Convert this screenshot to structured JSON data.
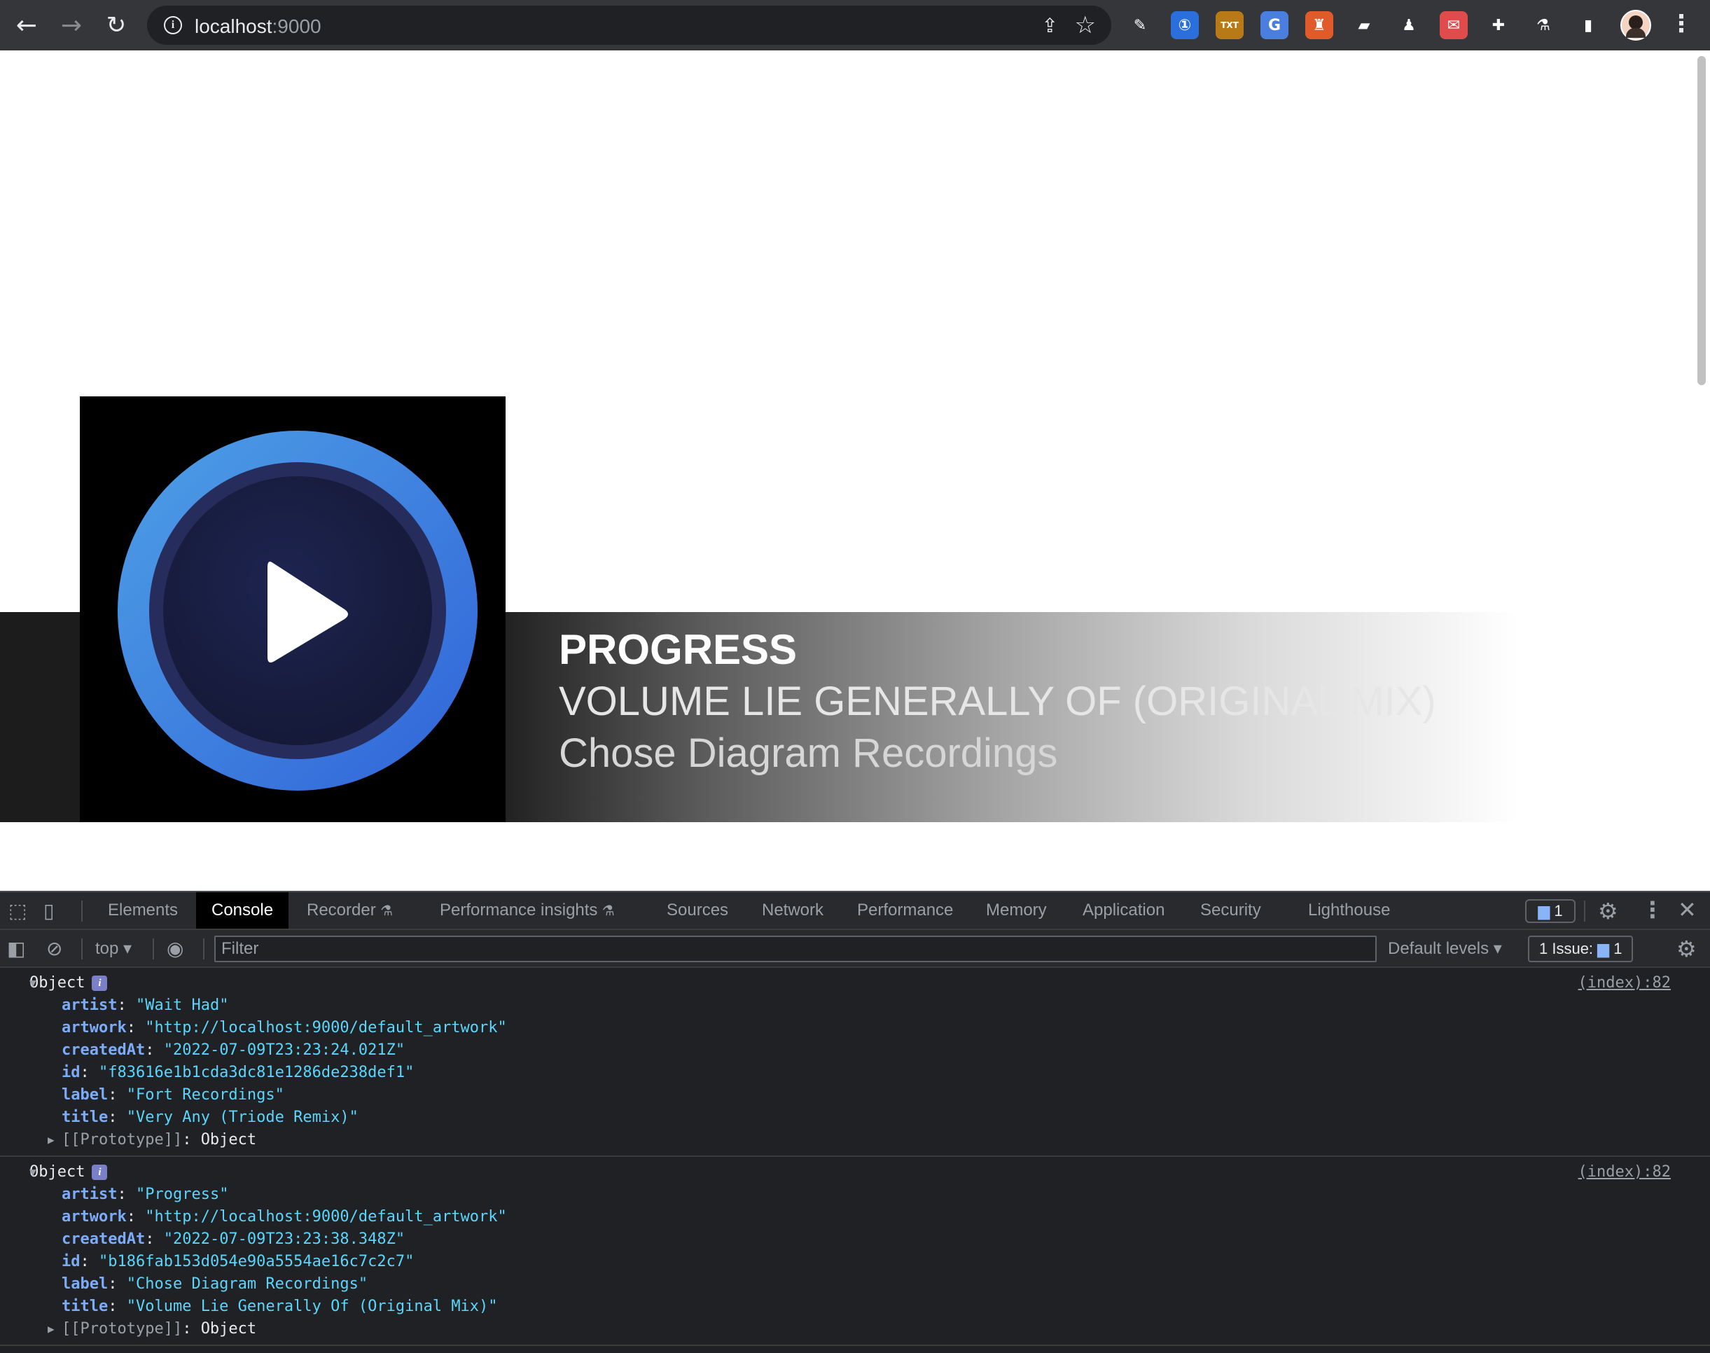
{
  "browser": {
    "url_host": "localhost",
    "url_port": ":9000",
    "extensions": [
      {
        "name": "pen-extension-icon",
        "glyph": "✎",
        "color": "#35363a"
      },
      {
        "name": "password-manager-icon",
        "glyph": "①",
        "color": "#2a6fdb"
      },
      {
        "name": "txt-extension-icon",
        "glyph": "TXT",
        "color": "#b87a16"
      },
      {
        "name": "translate-icon",
        "glyph": "G",
        "color": "#4a7fe0"
      },
      {
        "name": "castle-extension-icon",
        "glyph": "♜",
        "color": "#e05a2a"
      },
      {
        "name": "card-extension-icon",
        "glyph": "▰",
        "color": "#35363a"
      },
      {
        "name": "ghost-extension-icon",
        "glyph": "♟",
        "color": "#35363a"
      },
      {
        "name": "cat-extension-icon",
        "glyph": "✉",
        "color": "#e04b4b"
      },
      {
        "name": "puzzle-icon",
        "glyph": "✚",
        "color": "#35363a"
      },
      {
        "name": "flask-icon",
        "glyph": "⚗",
        "color": "#35363a"
      },
      {
        "name": "sidepanel-icon",
        "glyph": "▮",
        "color": "#35363a"
      }
    ]
  },
  "player": {
    "artist": "PROGRESS",
    "title": "VOLUME LIE GENERALLY OF (ORIGINAL MIX)",
    "label": "Chose Diagram Recordings"
  },
  "devtools": {
    "tabs": [
      "Elements",
      "Console",
      "Recorder",
      "Performance insights",
      "Sources",
      "Network",
      "Performance",
      "Memory",
      "Application",
      "Security",
      "Lighthouse"
    ],
    "active_tab": "Console",
    "message_count": "1",
    "context": "top",
    "filter_placeholder": "Filter",
    "levels": "Default levels",
    "issues_label": "1 Issue:",
    "issues_count": "1"
  },
  "console_entries": [
    {
      "header": "Object",
      "source": "(index):82",
      "props": [
        {
          "key": "artist",
          "value": "\"Wait Had\""
        },
        {
          "key": "artwork",
          "value": "\"http://localhost:9000/default_artwork\""
        },
        {
          "key": "createdAt",
          "value": "\"2022-07-09T23:23:24.021Z\""
        },
        {
          "key": "id",
          "value": "\"f83616e1b1cda3dc81e1286de238def1\""
        },
        {
          "key": "label",
          "value": "\"Fort Recordings\""
        },
        {
          "key": "title",
          "value": "\"Very Any (Triode Remix)\""
        }
      ],
      "prototype_key": "[[Prototype]]",
      "prototype_value": "Object"
    },
    {
      "header": "Object",
      "source": "(index):82",
      "props": [
        {
          "key": "artist",
          "value": "\"Progress\""
        },
        {
          "key": "artwork",
          "value": "\"http://localhost:9000/default_artwork\""
        },
        {
          "key": "createdAt",
          "value": "\"2022-07-09T23:23:38.348Z\""
        },
        {
          "key": "id",
          "value": "\"b186fab153d054e90a5554ae16c7c2c7\""
        },
        {
          "key": "label",
          "value": "\"Chose Diagram Recordings\""
        },
        {
          "key": "title",
          "value": "\"Volume Lie Generally Of (Original Mix)\""
        }
      ],
      "prototype_key": "[[Prototype]]",
      "prototype_value": "Object"
    }
  ]
}
